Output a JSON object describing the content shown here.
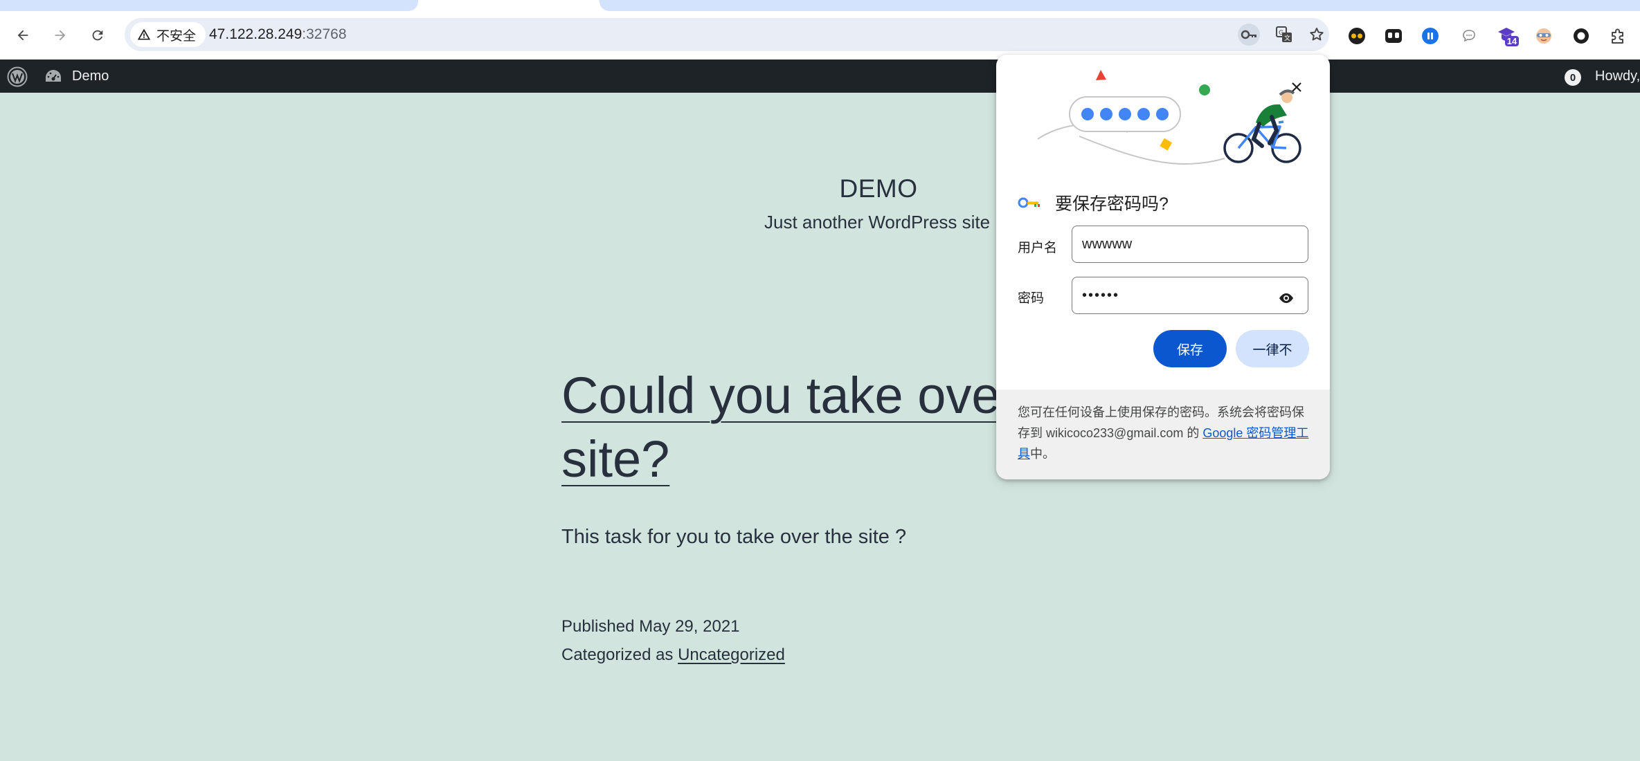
{
  "browser": {
    "security_label": "不安全",
    "url_host": "47.122.28.249",
    "url_port": ":32768"
  },
  "icons": {
    "back": "back-arrow-icon",
    "forward": "forward-arrow-icon",
    "reload": "reload-icon",
    "warning": "warning-icon",
    "key": "key-icon",
    "translate": "translate-icon",
    "star": "bookmark-star-icon"
  },
  "extensions": {
    "badge_count": "14"
  },
  "adminbar": {
    "site_name": "Demo",
    "comment_count": "0",
    "howdy": "Howdy,"
  },
  "site": {
    "title": "DEMO",
    "description": "Just another WordPress site"
  },
  "post": {
    "title": "Could you take over the site?",
    "excerpt": "This task for you to take over the site ?",
    "published": "Published May 29, 2021",
    "categorized_prefix": "Categorized as ",
    "category": "Uncategorized"
  },
  "password_bubble": {
    "heading": "要保存密码吗?",
    "username_label": "用户名",
    "username_value": "wwwww",
    "password_label": "密码",
    "password_value": "••••••",
    "save_label": "保存",
    "never_label": "一律不",
    "footer_text_1": "您可在任何设备上使用保存的密码。系统会将密码保存到 wikicoco233@gmail.com 的 ",
    "footer_link": "Google 密码管理工具",
    "footer_text_2": "中。"
  },
  "colors": {
    "page_bg": "#d1e4dd",
    "adminbar_bg": "#1d2327",
    "accent_blue": "#0b57d0",
    "text_dark": "#28303d"
  }
}
